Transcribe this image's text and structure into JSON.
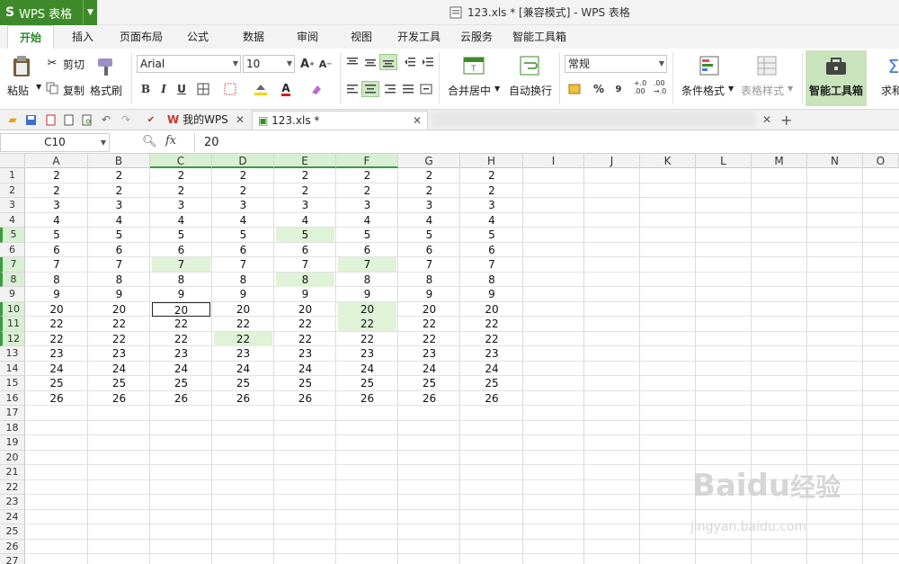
{
  "app": {
    "logo_letter": "S",
    "name": "WPS 表格",
    "window_title": "123.xls * [兼容模式] - WPS 表格"
  },
  "menu_tabs": [
    "开始",
    "插入",
    "页面布局",
    "公式",
    "数据",
    "审阅",
    "视图",
    "开发工具",
    "云服务",
    "智能工具箱"
  ],
  "ribbon": {
    "paste": "粘贴",
    "cut": "剪切",
    "copy": "复制",
    "format_painter": "格式刷",
    "font_name": "Arial",
    "font_size": "10",
    "merge_center": "合并居中",
    "wrap_text": "自动换行",
    "number_format": "常规",
    "percent": "%",
    "comma": "9",
    "conditional_format": "条件格式",
    "table_style": "表格样式",
    "smart_toolbox": "智能工具箱",
    "sum": "求和"
  },
  "doc_tabs": [
    {
      "label": "我的WPS"
    },
    {
      "label": "123.xls *"
    }
  ],
  "formula": {
    "name_box": "C10",
    "fx": "fx",
    "value": "20"
  },
  "columns": [
    "A",
    "B",
    "C",
    "D",
    "E",
    "F",
    "G",
    "H",
    "I",
    "J",
    "K",
    "L",
    "M",
    "N",
    "O"
  ],
  "rows": [
    "1",
    "2",
    "3",
    "4",
    "5",
    "6",
    "7",
    "8",
    "9",
    "10",
    "11",
    "12",
    "13",
    "14",
    "15",
    "16",
    "17",
    "18",
    "19",
    "20",
    "21",
    "22",
    "23",
    "24",
    "25",
    "26",
    "27"
  ],
  "cells": [
    [
      "2",
      "2",
      "2",
      "2",
      "2",
      "2",
      "2",
      "2"
    ],
    [
      "2",
      "2",
      "2",
      "2",
      "2",
      "2",
      "2",
      "2"
    ],
    [
      "3",
      "3",
      "3",
      "3",
      "3",
      "3",
      "3",
      "3"
    ],
    [
      "4",
      "4",
      "4",
      "4",
      "4",
      "4",
      "4",
      "4"
    ],
    [
      "5",
      "5",
      "5",
      "5",
      "5",
      "5",
      "5",
      "5"
    ],
    [
      "6",
      "6",
      "6",
      "6",
      "6",
      "6",
      "6",
      "6"
    ],
    [
      "7",
      "7",
      "7",
      "7",
      "7",
      "7",
      "7",
      "7"
    ],
    [
      "8",
      "8",
      "8",
      "8",
      "8",
      "8",
      "8",
      "8"
    ],
    [
      "9",
      "9",
      "9",
      "9",
      "9",
      "9",
      "9",
      "9"
    ],
    [
      "20",
      "20",
      "20",
      "20",
      "20",
      "20",
      "20",
      "20"
    ],
    [
      "22",
      "22",
      "22",
      "22",
      "22",
      "22",
      "22",
      "22"
    ],
    [
      "22",
      "22",
      "22",
      "22",
      "22",
      "22",
      "22",
      "22"
    ],
    [
      "23",
      "23",
      "23",
      "23",
      "23",
      "23",
      "23",
      "23"
    ],
    [
      "24",
      "24",
      "24",
      "24",
      "24",
      "24",
      "24",
      "24"
    ],
    [
      "25",
      "25",
      "25",
      "25",
      "25",
      "25",
      "25",
      "25"
    ],
    [
      "26",
      "26",
      "26",
      "26",
      "26",
      "26",
      "26",
      "26"
    ]
  ],
  "watermark": {
    "brand": "Baidu",
    "sub": "经验",
    "url": "jingyan.baidu.com"
  },
  "colors": {
    "accent": "#3e8a2a",
    "highlight": "#e0f2d8"
  }
}
